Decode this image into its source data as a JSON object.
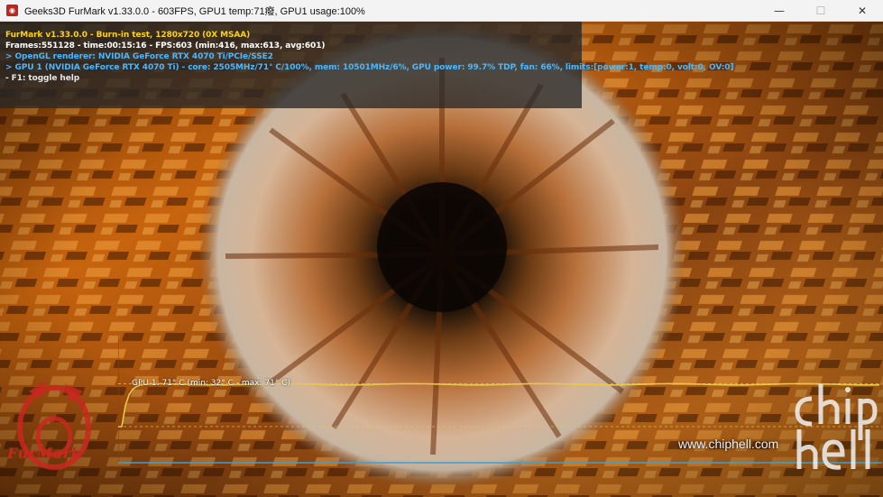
{
  "window": {
    "title": "Geeks3D FurMark v1.33.0.0 - 603FPS, GPU1 temp:71癈, GPU1 usage:100%",
    "icon": "furmark-app-icon",
    "controls": {
      "minimize": "—",
      "maximize": "☐",
      "close": "✕"
    }
  },
  "hud": {
    "line1": "FurMark v1.33.0.0 - Burn-in test, 1280x720 (0X MSAA)",
    "line2": "Frames:551128 - time:00:15:16 - FPS:603 (min:416, max:613, avg:601)",
    "line3": "> OpenGL renderer: NVIDIA GeForce RTX 4070 Ti/PCIe/SSE2",
    "line4": "> GPU 1 (NVIDIA GeForce RTX 4070 Ti) - core: 2505MHz/71° C/100%, mem: 10501MHz/6%, GPU power: 99.7% TDP, fan: 66%, limits:[power:1, temp:0, volt:0, OV:0]",
    "line5": "- F1: toggle help"
  },
  "graph": {
    "label": "GPU 1: 71° C (min: 32° C - max: 71° C)",
    "line_color": "#e8c84a",
    "frame_color": "#3aa0d8",
    "marker_color": "#c81e1e",
    "current_temp": 71,
    "min_temp": 32,
    "max_temp": 71
  },
  "branding": {
    "logo_text": "FurMark",
    "watermark_url": "www.chiphell.com",
    "watermark_mark": "chip hell"
  }
}
